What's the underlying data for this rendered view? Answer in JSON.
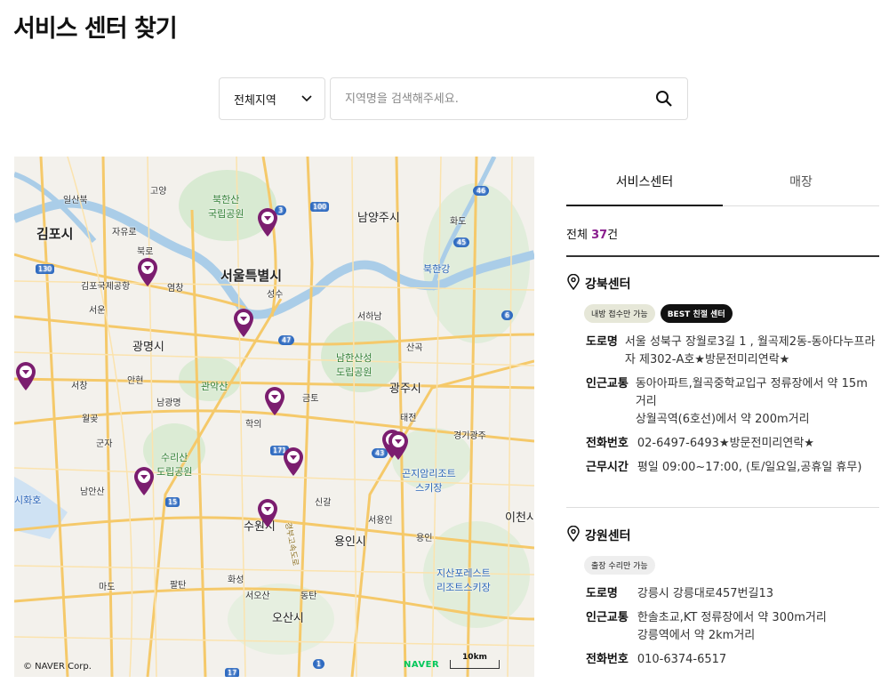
{
  "title": "서비스 센터 찾기",
  "search": {
    "region": "전체지역",
    "placeholder": "지역명을 검색해주세요."
  },
  "map": {
    "labels": {
      "gimpo_si": "김포시",
      "seoul": "서울특별시",
      "gwangmyeong": "광명시",
      "namyangju": "남양주시",
      "gwangju": "광주시",
      "suwon": "수원시",
      "yongin": "용인시",
      "osan": "오산시",
      "icheon": "이천시",
      "bukhansan": "북한산\n국립공원",
      "namhansanseong": "남한산성\n도립공원",
      "gwanaksan": "관악산",
      "suri": "수리산\n도립공원",
      "gimpo_airport": "김포국제공항",
      "ilsanbuk": "일산북",
      "goyang": "고양",
      "jayuro": "자유로",
      "bukro": "북로",
      "yeomgang": "염창",
      "seoun": "서운",
      "seongsu": "성수",
      "seohanam": "서하남",
      "sangok": "산곡",
      "hwado": "화도",
      "bukhangang": "북한강",
      "seochang": "서창",
      "ansan_ic": "안현",
      "namgwangmyeong": "남광명",
      "geumto": "금토",
      "hagui": "학의",
      "taejeon": "태전",
      "gyeonggi_gwangju": "경기광주",
      "gonjiam": "곤지암리조트\n스키장",
      "wolgot": "월곶",
      "gunja": "군자",
      "namansan": "남안산",
      "sihwa": "시화호",
      "singal": "신갈",
      "seoyongin": "서용인",
      "yongin_ic": "용인",
      "jisan": "지산포레스트\n리조트스키장",
      "mado": "마도",
      "paltan": "팔탄",
      "hwaseong": "화성",
      "seoosan": "서오산",
      "dongtan": "동탄",
      "gyeongbu": "경부고속도로"
    },
    "road_numbers": [
      "3",
      "100",
      "46",
      "45",
      "130",
      "6",
      "47",
      "171",
      "43",
      "15",
      "17",
      "1"
    ],
    "copyright": "© NAVER Corp.",
    "logo": "NAVER",
    "scale": "10km",
    "marker_color": "#7b1d6f"
  },
  "tabs": [
    {
      "label": "서비스센터",
      "active": true
    },
    {
      "label": "매장",
      "active": false
    }
  ],
  "count": {
    "prefix": "전체 ",
    "number": "37",
    "suffix": "건"
  },
  "centers": [
    {
      "name": "강북센터",
      "badges": [
        "내방 접수만 가능",
        "BEST 친절 센터"
      ],
      "address_key": "도로명",
      "address": "서울 성북구 장월로3길 1 , 월곡제2동-동아다누프라자 제302-A호★방문전미리연락★",
      "transit_key": "인근교통",
      "transit_1": "동아아파트,월곡중학교입구 정류장에서 약 15m 거리",
      "transit_2": "상월곡역(6호선)에서 약 200m거리",
      "phone_key": "전화번호",
      "phone": "02-6497-6493★방문전미리연락★",
      "hours_key": "근무시간",
      "hours": "평일 09:00~17:00, (토/일요일,공휴일 휴무)"
    },
    {
      "name": "강원센터",
      "badges": [
        "출장 수리만 가능"
      ],
      "address_key": "도로명",
      "address": "강릉시 강릉대로457번길13",
      "transit_key": "인근교통",
      "transit_1": "한솔초교,KT 정류장에서 약 300m거리",
      "transit_2": "강릉역에서 약 2km거리",
      "phone_key": "전화번호",
      "phone": "010-6374-6517"
    }
  ]
}
